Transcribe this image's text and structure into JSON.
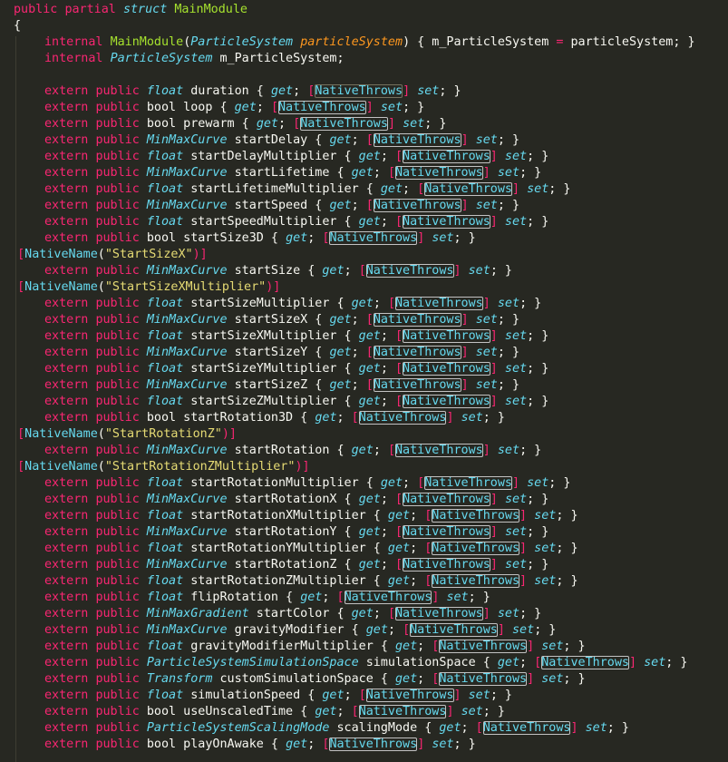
{
  "editor": {
    "header": [
      {
        "t": "public partial struct MainModule",
        "segs": [
          [
            "k",
            "public"
          ],
          [
            "p",
            " "
          ],
          [
            "k",
            "partial"
          ],
          [
            "p",
            " "
          ],
          [
            "s",
            "struct"
          ],
          [
            "p",
            " "
          ],
          [
            "id",
            "MainModule"
          ]
        ]
      },
      {
        "segs": [
          [
            "p",
            "{"
          ]
        ]
      },
      {
        "indent": 1,
        "segs": [
          [
            "k",
            "internal"
          ],
          [
            "p",
            " "
          ],
          [
            "id",
            "MainModule"
          ],
          [
            "p",
            "("
          ],
          [
            "t",
            "ParticleSystem"
          ],
          [
            "p",
            " "
          ],
          [
            "v",
            "particleSystem"
          ],
          [
            "p",
            ") { m_ParticleSystem "
          ],
          [
            "k",
            "="
          ],
          [
            "p",
            " particleSystem; }"
          ]
        ]
      },
      {
        "indent": 1,
        "segs": [
          [
            "k",
            "internal"
          ],
          [
            "p",
            " "
          ],
          [
            "t",
            "ParticleSystem"
          ],
          [
            "p",
            " m_ParticleSystem;"
          ]
        ]
      },
      {
        "indent": 1,
        "segs": []
      }
    ],
    "properties": [
      {
        "type": "float",
        "name": "duration"
      },
      {
        "type": "bool",
        "name": "loop"
      },
      {
        "type": "bool",
        "name": "prewarm"
      },
      {
        "type": "MinMaxCurve",
        "name": "startDelay"
      },
      {
        "type": "float",
        "name": "startDelayMultiplier"
      },
      {
        "type": "MinMaxCurve",
        "name": "startLifetime"
      },
      {
        "type": "float",
        "name": "startLifetimeMultiplier"
      },
      {
        "type": "MinMaxCurve",
        "name": "startSpeed"
      },
      {
        "type": "float",
        "name": "startSpeedMultiplier"
      },
      {
        "type": "bool",
        "name": "startSize3D"
      },
      {
        "attr": "StartSizeX"
      },
      {
        "type": "MinMaxCurve",
        "name": "startSize"
      },
      {
        "attr": "StartSizeXMultiplier"
      },
      {
        "type": "float",
        "name": "startSizeMultiplier"
      },
      {
        "type": "MinMaxCurve",
        "name": "startSizeX"
      },
      {
        "type": "float",
        "name": "startSizeXMultiplier"
      },
      {
        "type": "MinMaxCurve",
        "name": "startSizeY"
      },
      {
        "type": "float",
        "name": "startSizeYMultiplier"
      },
      {
        "type": "MinMaxCurve",
        "name": "startSizeZ"
      },
      {
        "type": "float",
        "name": "startSizeZMultiplier"
      },
      {
        "type": "bool",
        "name": "startRotation3D"
      },
      {
        "attr": "StartRotationZ"
      },
      {
        "type": "MinMaxCurve",
        "name": "startRotation"
      },
      {
        "attr": "StartRotationZMultiplier"
      },
      {
        "type": "float",
        "name": "startRotationMultiplier"
      },
      {
        "type": "MinMaxCurve",
        "name": "startRotationX"
      },
      {
        "type": "float",
        "name": "startRotationXMultiplier"
      },
      {
        "type": "MinMaxCurve",
        "name": "startRotationY"
      },
      {
        "type": "float",
        "name": "startRotationYMultiplier"
      },
      {
        "type": "MinMaxCurve",
        "name": "startRotationZ"
      },
      {
        "type": "float",
        "name": "startRotationZMultiplier"
      },
      {
        "type": "float",
        "name": "flipRotation"
      },
      {
        "type": "MinMaxGradient",
        "name": "startColor"
      },
      {
        "type": "MinMaxCurve",
        "name": "gravityModifier"
      },
      {
        "type": "float",
        "name": "gravityModifierMultiplier"
      },
      {
        "type": "ParticleSystemSimulationSpace",
        "name": "simulationSpace"
      },
      {
        "type": "Transform",
        "name": "customSimulationSpace"
      },
      {
        "type": "float",
        "name": "simulationSpeed"
      },
      {
        "type": "bool",
        "name": "useUnscaledTime"
      },
      {
        "type": "ParticleSystemScalingMode",
        "name": "scalingMode"
      },
      {
        "type": "bool",
        "name": "playOnAwake"
      }
    ],
    "keywords": {
      "extern": "extern",
      "public": "public",
      "get": "get",
      "set": "set",
      "native_throws": "NativeThrows",
      "native_name": "NativeName"
    },
    "primitive_types": [
      "float",
      "bool"
    ]
  }
}
